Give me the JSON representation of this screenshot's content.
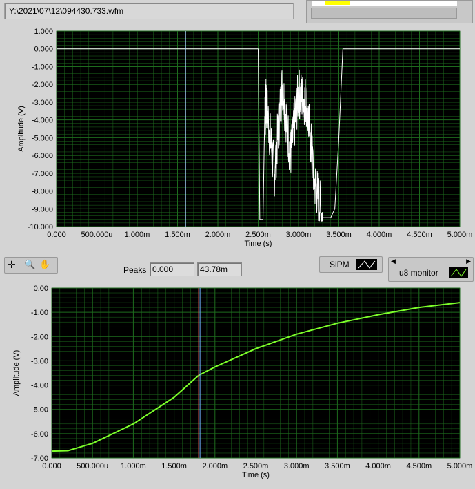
{
  "file_path": "Y:\\2021\\07\\12\\094430.733.wfm",
  "toolbar": {
    "peaks_label": "Peaks",
    "peak_min": "0.000",
    "peak_max": "43.78m",
    "legend_sipm": "SiPM",
    "legend_u8": "u8 monitor"
  },
  "colors": {
    "plot_bg": "#000000",
    "grid": "#1e6b1e",
    "trace_top": "#ffffff",
    "trace_bottom": "#7dff2a",
    "cursor_top": "#a8d8ff",
    "cursor_bottom_a": "#ff6060",
    "cursor_bottom_b": "#70b0ff"
  },
  "chart_data": [
    {
      "type": "line",
      "xlabel": "Time (s)",
      "ylabel": "Amplitude (V)",
      "ylim": [
        -10,
        1
      ],
      "xlim": [
        0,
        0.005
      ],
      "grid": true,
      "yticks": [
        "1.000",
        "0.000",
        "-1.000",
        "-2.000",
        "-3.000",
        "-4.000",
        "-5.000",
        "-6.000",
        "-7.000",
        "-8.000",
        "-9.000",
        "-10.000"
      ],
      "xticks": [
        "0.000",
        "500.000u",
        "1.000m",
        "1.500m",
        "2.000m",
        "2.500m",
        "3.000m",
        "3.500m",
        "4.000m",
        "4.500m",
        "5.000m"
      ],
      "cursor_x": 0.0016,
      "series": [
        {
          "name": "SiPM",
          "x": [
            0,
            0.0025,
            0.00252,
            0.00256,
            0.00258,
            0.0026,
            0.0027,
            0.0028,
            0.0029,
            0.003,
            0.0031,
            0.0032,
            0.0033,
            0.0034,
            0.00345,
            0.0035,
            0.00355,
            0.005
          ],
          "y": [
            0,
            0,
            -9.6,
            -9.6,
            -4,
            -3,
            -7,
            -2,
            -6,
            -2.5,
            -3,
            -7.5,
            -9.5,
            -9.5,
            -9,
            -5,
            0,
            0
          ]
        }
      ]
    },
    {
      "type": "line",
      "xlabel": "Time (s)",
      "ylabel": "Amplitude (V)",
      "ylim": [
        -7,
        0
      ],
      "xlim": [
        0,
        0.005
      ],
      "grid": true,
      "yticks": [
        "0.00",
        "-1.00",
        "-2.00",
        "-3.00",
        "-4.00",
        "-5.00",
        "-6.00",
        "-7.00"
      ],
      "xticks": [
        "0.000",
        "500.000u",
        "1.000m",
        "1.500m",
        "2.000m",
        "2.500m",
        "3.000m",
        "3.500m",
        "4.000m",
        "4.500m",
        "5.000m"
      ],
      "cursor_x": 0.0018,
      "series": [
        {
          "name": "u8 monitor",
          "x": [
            0,
            0.0002,
            0.0005,
            0.001,
            0.0015,
            0.0018,
            0.002,
            0.0025,
            0.003,
            0.0035,
            0.004,
            0.0045,
            0.005
          ],
          "y": [
            -6.72,
            -6.7,
            -6.4,
            -5.6,
            -4.5,
            -3.6,
            -3.25,
            -2.5,
            -1.9,
            -1.45,
            -1.1,
            -0.8,
            -0.6
          ]
        }
      ]
    }
  ]
}
